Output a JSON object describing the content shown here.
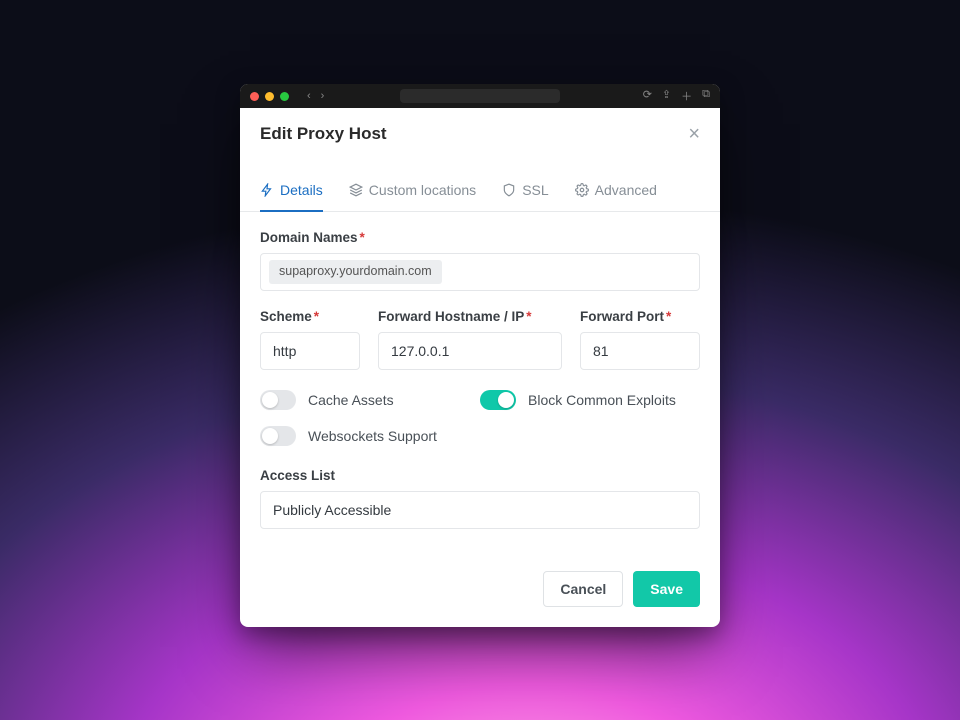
{
  "modal": {
    "title": "Edit Proxy Host"
  },
  "tabs": {
    "details": "Details",
    "custom_locations": "Custom locations",
    "ssl": "SSL",
    "advanced": "Advanced"
  },
  "labels": {
    "domain_names": "Domain Names",
    "scheme": "Scheme",
    "forward_hostname": "Forward Hostname / IP",
    "forward_port": "Forward Port",
    "cache_assets": "Cache Assets",
    "block_exploits": "Block Common Exploits",
    "websockets": "Websockets Support",
    "access_list": "Access List"
  },
  "values": {
    "domain_chip": "supaproxy.yourdomain.com",
    "scheme": "http",
    "forward_hostname": "127.0.0.1",
    "forward_port": "81",
    "access_list": "Publicly Accessible"
  },
  "toggles": {
    "cache_assets": false,
    "block_exploits": true,
    "websockets": false
  },
  "buttons": {
    "cancel": "Cancel",
    "save": "Save"
  }
}
